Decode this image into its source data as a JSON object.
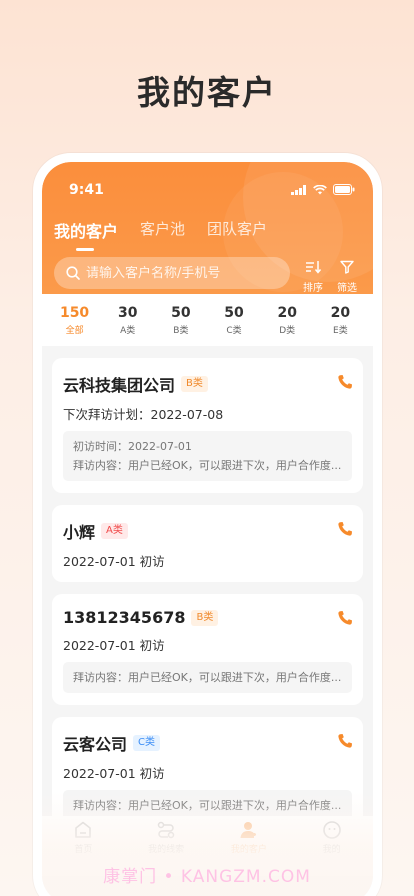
{
  "headline": "我的客户",
  "status": {
    "time": "9:41"
  },
  "tabs": [
    {
      "label": "我的客户",
      "active": true
    },
    {
      "label": "客户池",
      "active": false
    },
    {
      "label": "团队客户",
      "active": false
    }
  ],
  "search": {
    "placeholder": "请输入客户名称/手机号"
  },
  "tools": {
    "sort_label": "排序",
    "filter_label": "筛选"
  },
  "counts": [
    {
      "n": "150",
      "t": "全部",
      "active": true
    },
    {
      "n": "30",
      "t": "A类"
    },
    {
      "n": "50",
      "t": "B类"
    },
    {
      "n": "50",
      "t": "C类"
    },
    {
      "n": "20",
      "t": "D类"
    },
    {
      "n": "20",
      "t": "E类"
    }
  ],
  "customers": [
    {
      "name": "云科技集团公司",
      "badge": "B类",
      "sub": "下次拜访计划：2022-07-08",
      "note1": "初访时间：2022-07-01",
      "note2": "拜访内容：用户已经OK，可以跟进下次，用户合作度..."
    },
    {
      "name": "小辉",
      "badge": "A类",
      "sub": "2022-07-01 初访"
    },
    {
      "name": "13812345678",
      "badge": "B类",
      "sub": "2022-07-01 初访",
      "note2": "拜访内容：用户已经OK，可以跟进下次，用户合作度..."
    },
    {
      "name": "云客公司",
      "badge": "C类",
      "sub": "2022-07-01 初访",
      "note2": "拜访内容：用户已经OK，可以跟进下次，用户合作度..."
    }
  ],
  "tabbar": [
    {
      "label": "首页",
      "icon": "home-icon"
    },
    {
      "label": "我的线索",
      "icon": "leads-icon"
    },
    {
      "label": "我的客户",
      "icon": "customer-icon",
      "active": true
    },
    {
      "label": "我的",
      "icon": "profile-icon"
    }
  ],
  "watermark": "康掌门 • KANGZM.COM",
  "colors": {
    "accent": "#f68a2b",
    "hero": "#fb8e3c"
  }
}
